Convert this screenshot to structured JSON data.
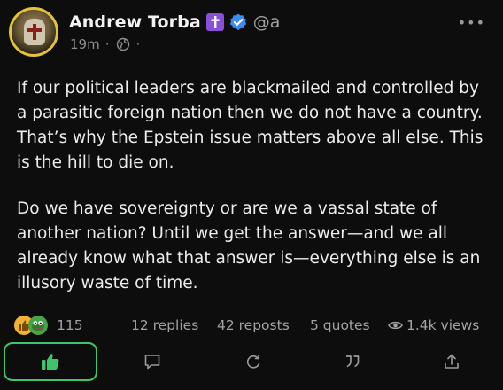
{
  "post": {
    "author": {
      "display_name": "Andrew Torba",
      "handle": "@a",
      "badges": [
        "cross-badge",
        "verified-badge"
      ]
    },
    "time": "19m",
    "meta_separator": "·",
    "visibility_icon": "globe-icon",
    "paragraphs": [
      "If our political leaders are blackmailed and controlled by a parasitic foreign nation then we do not have a country. That’s why the Epstein issue matters above all else. This is the hill to die on.",
      "Do we have sovereignty or are we a vassal state of another nation? Until we get the answer—and we all already know what that answer is—everything else is an illusory waste of time."
    ],
    "stats": {
      "reaction_count": "115",
      "replies": "12 replies",
      "reposts": "42 reposts",
      "quotes": "5 quotes",
      "views": "1.4k views"
    },
    "actions": [
      {
        "name": "like-button",
        "icon": "thumbs-up-icon",
        "active": true
      },
      {
        "name": "reply-button",
        "icon": "comment-icon"
      },
      {
        "name": "repost-button",
        "icon": "repost-icon"
      },
      {
        "name": "quote-button",
        "icon": "quote-icon"
      },
      {
        "name": "share-button",
        "icon": "share-icon"
      }
    ]
  },
  "colors": {
    "background": "#0d0d0d",
    "text": "#ececec",
    "muted": "#8e8e8e",
    "verified": "#3b8cf0",
    "cross_badge": "#8a4fd8",
    "like_accent": "#3ec46a"
  }
}
